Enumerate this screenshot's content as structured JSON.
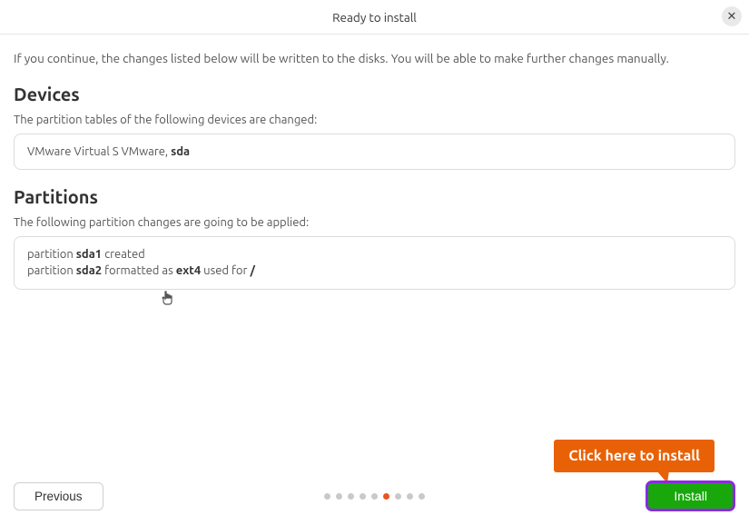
{
  "title": "Ready to install",
  "close_icon_glyph": "✕",
  "intro": "If you continue, the changes listed below will be written to the disks. You will be able to make further changes manually.",
  "devices": {
    "heading": "Devices",
    "subtext": "The partition tables of the following devices are changed:",
    "entries": [
      {
        "prefix": "VMware Virtual S VMware, ",
        "bold": "sda"
      }
    ]
  },
  "partitions": {
    "heading": "Partitions",
    "subtext": "The following partition changes are going to be applied:",
    "entries": [
      {
        "t0": "partition ",
        "b0": "sda1",
        "t1": " created",
        "b1": "",
        "t2": "",
        "b2": ""
      },
      {
        "t0": "partition ",
        "b0": "sda2",
        "t1": " formatted as ",
        "b1": "ext4",
        "t2": " used for ",
        "b2": "/"
      }
    ]
  },
  "callout": "Click here to install",
  "footer": {
    "previous": "Previous",
    "install": "Install",
    "dots_total": 9,
    "active_dot_index": 5
  }
}
